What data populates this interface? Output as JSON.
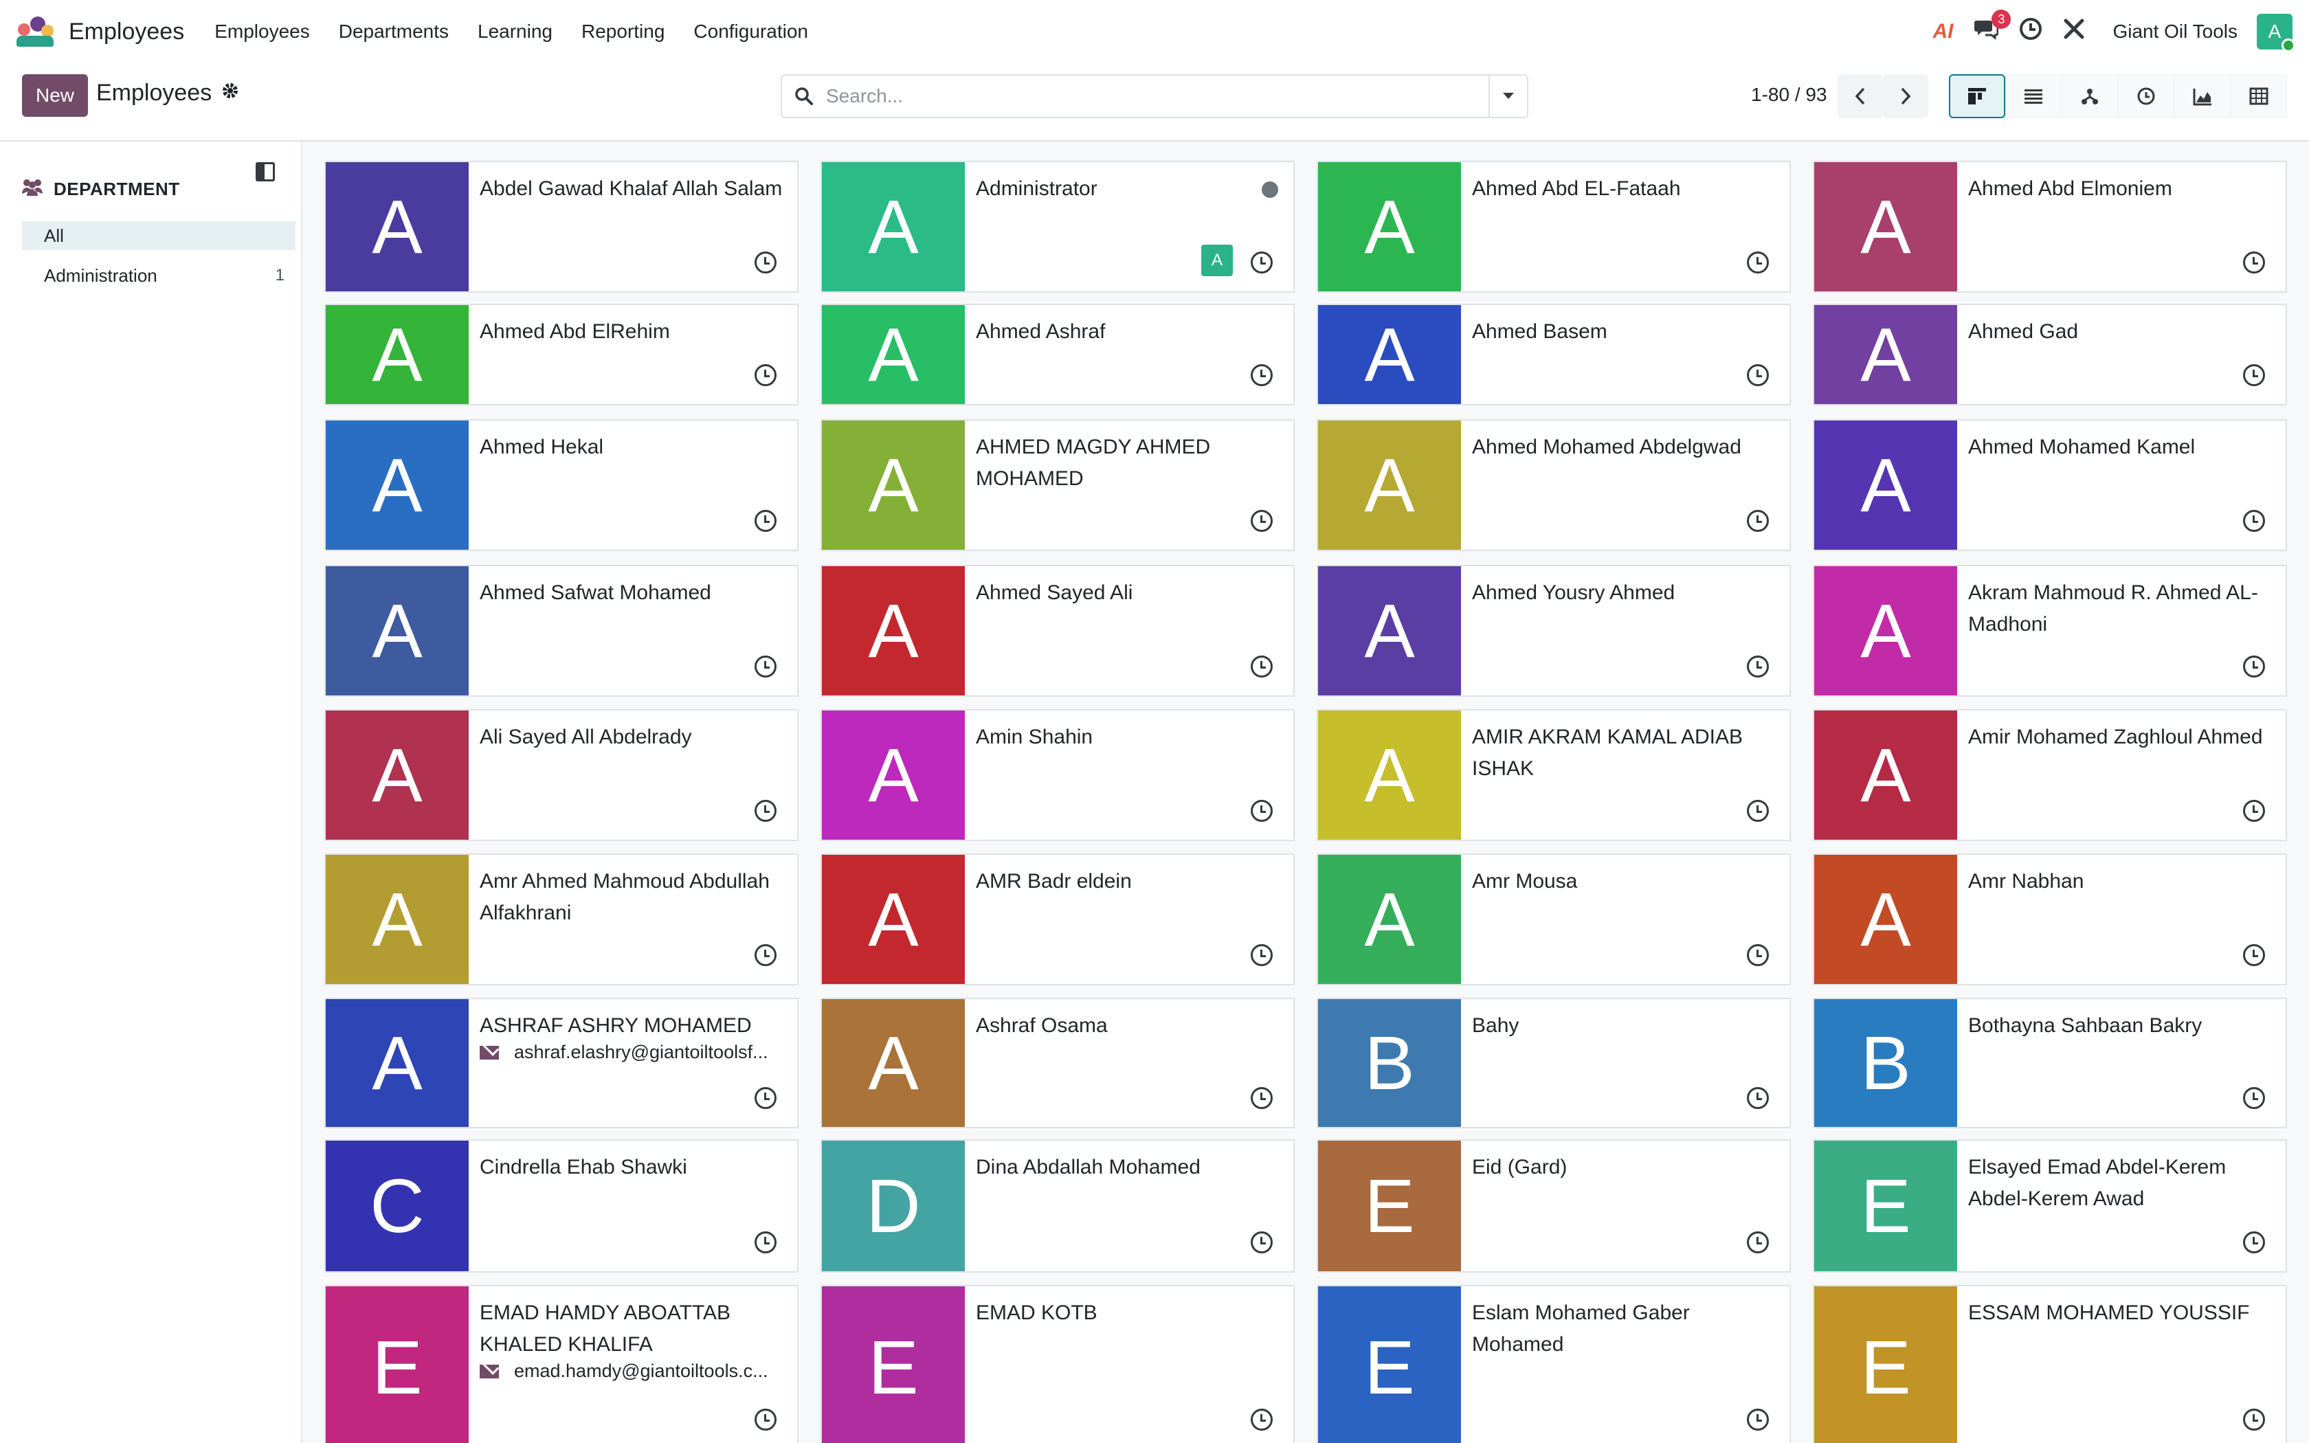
{
  "navbar": {
    "app_name": "Employees",
    "menu": [
      "Employees",
      "Departments",
      "Learning",
      "Reporting",
      "Configuration"
    ],
    "ai_label": "AI",
    "messages_count": "3",
    "company": "Giant Oil Tools",
    "user_initial": "A"
  },
  "control": {
    "new_label": "New",
    "breadcrumb": "Employees",
    "search_placeholder": "Search...",
    "pager": "1-80 / 93",
    "views": [
      "kanban",
      "list",
      "hierarchy",
      "activity",
      "graph",
      "pivot"
    ]
  },
  "sidebar": {
    "title": "DEPARTMENT",
    "items": [
      {
        "label": "All",
        "count": ""
      },
      {
        "label": "Administration",
        "count": "1"
      }
    ]
  },
  "cards": [
    {
      "name": "Abdel Gawad Khalaf Allah Salam",
      "initial": "A",
      "color": "#4A3C9E"
    },
    {
      "name": "Administrator",
      "initial": "A",
      "color": "#2ABB87",
      "user": "A",
      "presence": true
    },
    {
      "name": "Ahmed Abd EL-Fataah",
      "initial": "A",
      "color": "#2BB651"
    },
    {
      "name": "Ahmed Abd Elmoniem",
      "initial": "A",
      "color": "#A9406B"
    },
    {
      "name": "Ahmed Abd ElRehim",
      "initial": "A",
      "color": "#35B43A"
    },
    {
      "name": "Ahmed Ashraf",
      "initial": "A",
      "color": "#27BE65"
    },
    {
      "name": "Ahmed Basem",
      "initial": "A",
      "color": "#2A4CBF"
    },
    {
      "name": "Ahmed Gad",
      "initial": "A",
      "color": "#7240A0"
    },
    {
      "name": "Ahmed Hekal",
      "initial": "A",
      "color": "#2A6EC4"
    },
    {
      "name": "AHMED MAGDY AHMED MOHAMED",
      "initial": "A",
      "color": "#84B037"
    },
    {
      "name": "Ahmed Mohamed Abdelgwad",
      "initial": "A",
      "color": "#B6A933"
    },
    {
      "name": "Ahmed Mohamed Kamel",
      "initial": "A",
      "color": "#5535B2"
    },
    {
      "name": "Ahmed Safwat Mohamed",
      "initial": "A",
      "color": "#3F5BA0"
    },
    {
      "name": "Ahmed Sayed Ali",
      "initial": "A",
      "color": "#C2282E"
    },
    {
      "name": "Ahmed Yousry Ahmed",
      "initial": "A",
      "color": "#5B3EA4"
    },
    {
      "name": "Akram Mahmoud R. Ahmed AL-Madhoni",
      "initial": "A",
      "color": "#C22BA8"
    },
    {
      "name": "Ali Sayed All Abdelrady",
      "initial": "A",
      "color": "#B03150"
    },
    {
      "name": "Amin Shahin",
      "initial": "A",
      "color": "#BC29BC"
    },
    {
      "name": "AMIR AKRAM KAMAL ADIAB ISHAK",
      "initial": "A",
      "color": "#C6BE2B"
    },
    {
      "name": "Amir Mohamed Zaghloul Ahmed",
      "initial": "A",
      "color": "#B52B45"
    },
    {
      "name": "Amr Ahmed Mahmoud Abdullah Alfakhrani",
      "initial": "A",
      "color": "#B39D33"
    },
    {
      "name": "AMR Badr eldein",
      "initial": "A",
      "color": "#C2282E"
    },
    {
      "name": "Amr Mousa",
      "initial": "A",
      "color": "#35AE5B"
    },
    {
      "name": "Amr Nabhan",
      "initial": "A",
      "color": "#C24B26"
    },
    {
      "name": "ASHRAF ASHRY MOHAMED",
      "initial": "A",
      "color": "#2E45B5",
      "email": "ashraf.elashry@giantoiltoolsf..."
    },
    {
      "name": "Ashraf Osama",
      "initial": "A",
      "color": "#A9733A"
    },
    {
      "name": "Bahy",
      "initial": "B",
      "color": "#3E7AAF"
    },
    {
      "name": "Bothayna Sahbaan Bakry",
      "initial": "B",
      "color": "#2A7CC0"
    },
    {
      "name": "Cindrella Ehab Shawki",
      "initial": "C",
      "color": "#3333B2"
    },
    {
      "name": "Dina Abdallah Mohamed",
      "initial": "D",
      "color": "#44A3A3"
    },
    {
      "name": "Eid (Gard)",
      "initial": "E",
      "color": "#A86A3E"
    },
    {
      "name": "Elsayed Emad Abdel-Kerem Abdel-Kerem Awad",
      "initial": "E",
      "color": "#3AAD85"
    },
    {
      "name": "EMAD HAMDY ABOATTAB KHALED KHALIFA",
      "initial": "E",
      "color": "#C22780",
      "email": "emad.hamdy@giantoiltools.c..."
    },
    {
      "name": "EMAD KOTB",
      "initial": "E",
      "color": "#B02DA0"
    },
    {
      "name": "Eslam Mohamed Gaber Mohamed",
      "initial": "E",
      "color": "#2B63C2"
    },
    {
      "name": "ESSAM MOHAMED YOUSSIF",
      "initial": "E",
      "color": "#C29428"
    }
  ]
}
